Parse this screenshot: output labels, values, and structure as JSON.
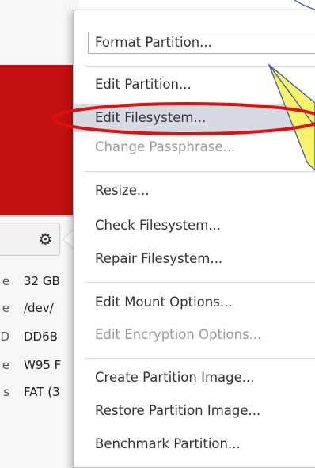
{
  "background": {
    "partition_color": "#c31010",
    "gear_icon": "gear-icon",
    "details": [
      {
        "key": "e",
        "value": "32 GB"
      },
      {
        "key": "e",
        "value": "/dev/"
      },
      {
        "key": "D",
        "value": "DD6B"
      },
      {
        "key": "e",
        "value": "W95 F"
      },
      {
        "key": "s",
        "value": "FAT (3"
      }
    ]
  },
  "menu": {
    "items": [
      {
        "label": "Format Partition...",
        "enabled": true
      },
      {
        "label": "Edit Partition...",
        "enabled": true
      },
      {
        "label": "Edit Filesystem...",
        "enabled": true,
        "highlighted": true
      },
      {
        "label": "Change Passphrase...",
        "enabled": false
      },
      {
        "label": "Resize...",
        "enabled": true
      },
      {
        "label": "Check Filesystem...",
        "enabled": true
      },
      {
        "label": "Repair Filesystem...",
        "enabled": true
      },
      {
        "label": "Edit Mount Options...",
        "enabled": true
      },
      {
        "label": "Edit Encryption Options...",
        "enabled": false
      },
      {
        "label": "Create Partition Image...",
        "enabled": true
      },
      {
        "label": "Restore Partition Image...",
        "enabled": true
      },
      {
        "label": "Benchmark Partition...",
        "enabled": true
      }
    ]
  },
  "annotation": {
    "highlight_ellipse_color": "#e01010",
    "callout_fill": "#f7f36a",
    "callout_stroke": "#2d4fa0"
  }
}
